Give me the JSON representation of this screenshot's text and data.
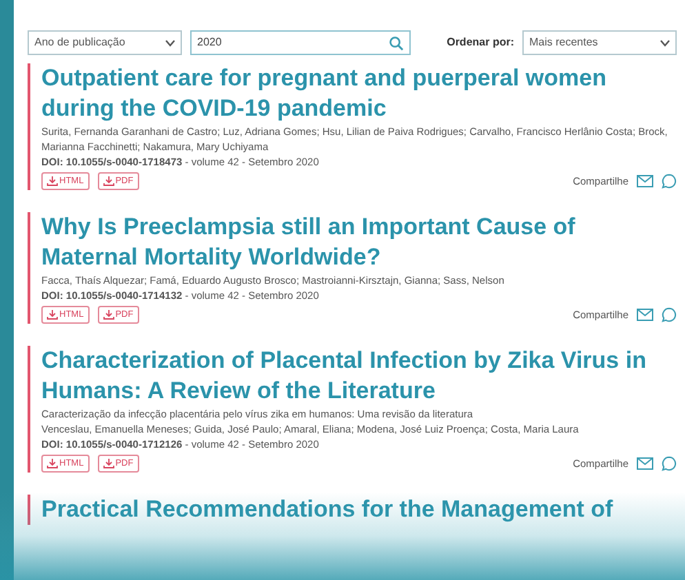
{
  "filters": {
    "year_select": "Ano de publicação",
    "year_search": "2020",
    "sort_label": "Ordenar por:",
    "sort_select": "Mais recentes"
  },
  "articles": [
    {
      "title": "Outpatient care for pregnant and puerperal women during the COVID-19 pandemic",
      "authors": "Surita, Fernanda Garanhani de Castro; Luz, Adriana Gomes; Hsu, Lilian de Paiva Rodrigues; Carvalho, Francisco Herlânio Costa; Brock, Marianna Facchinetti; Nakamura, Mary Uchiyama",
      "doi": "**DOI: 10.1055/s-0040-1718473** - volume 42 - Setembro 2020",
      "buttons": [
        "HTML",
        "PDF"
      ],
      "share": "Compartilhe"
    },
    {
      "title": "Why Is Preeclampsia still an Important Cause of Maternal Mortality Worldwide?",
      "authors": "Facca, Thaís Alquezar; Famá, Eduardo Augusto Brosco; Mastroianni-Kirsztajn, Gianna; Sass, Nelson",
      "doi": "**DOI: 10.1055/s-0040-1714132** - volume 42 - Setembro 2020",
      "buttons": [
        "HTML",
        "PDF"
      ],
      "share": "Compartilhe"
    },
    {
      "title": "Characterization of Placental Infection by Zika Virus in Humans: A Review of the Literature",
      "subtitle": "Caracterização da infecção placentária pelo vírus zika em humanos: Uma revisão da literatura",
      "authors": "Venceslau, Emanuella Meneses; Guida, José Paulo; Amaral, Eliana; Modena, José Luiz Proença; Costa, Maria Laura",
      "doi": "**DOI: 10.1055/s-0040-1712126** - volume 42 - Setembro 2020",
      "buttons": [
        "HTML",
        "PDF"
      ],
      "share": "Compartilhe"
    },
    {
      "title": "Practical Recommendations for the Management of"
    }
  ]
}
